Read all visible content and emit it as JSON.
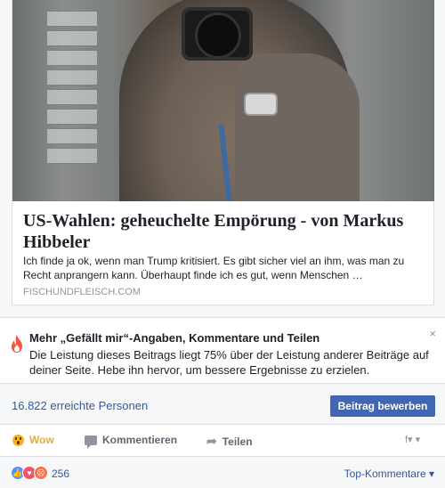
{
  "link_preview": {
    "title": "US-Wahlen: geheuchelte Empörung - von Markus Hibbeler",
    "description": "Ich finde ja ok, wenn man Trump kritisiert. Es gibt sicher viel an ihm, was man zu Recht anprangern kann. Überhaupt finde ich es gut, wenn Menschen …",
    "domain": "FISCHUNDFLEISCH.COM"
  },
  "boost_notice": {
    "title": "Mehr „Gefällt mir“-Angaben, Kommentare und Teilen",
    "text": "Die Leistung dieses Beitrags liegt 75% über der Leistung anderer Beiträge auf deiner Seite. Hebe ihn hervor, um bessere Ergebnisse zu erzielen.",
    "close": "×"
  },
  "reach": {
    "text": "16.822 erreichte Personen",
    "boost_button": "Beitrag bewerben"
  },
  "actions": {
    "wow": "Wow",
    "comment": "Kommentieren",
    "share": "Teilen",
    "page_switch": "f▾ ▾"
  },
  "reactions": {
    "count": "256",
    "top_comments": "Top-Kommentare ▾"
  },
  "colors": {
    "accent": "#4267b2",
    "link": "#365899",
    "wow": "#f7b125",
    "fire": "#f5533d"
  }
}
